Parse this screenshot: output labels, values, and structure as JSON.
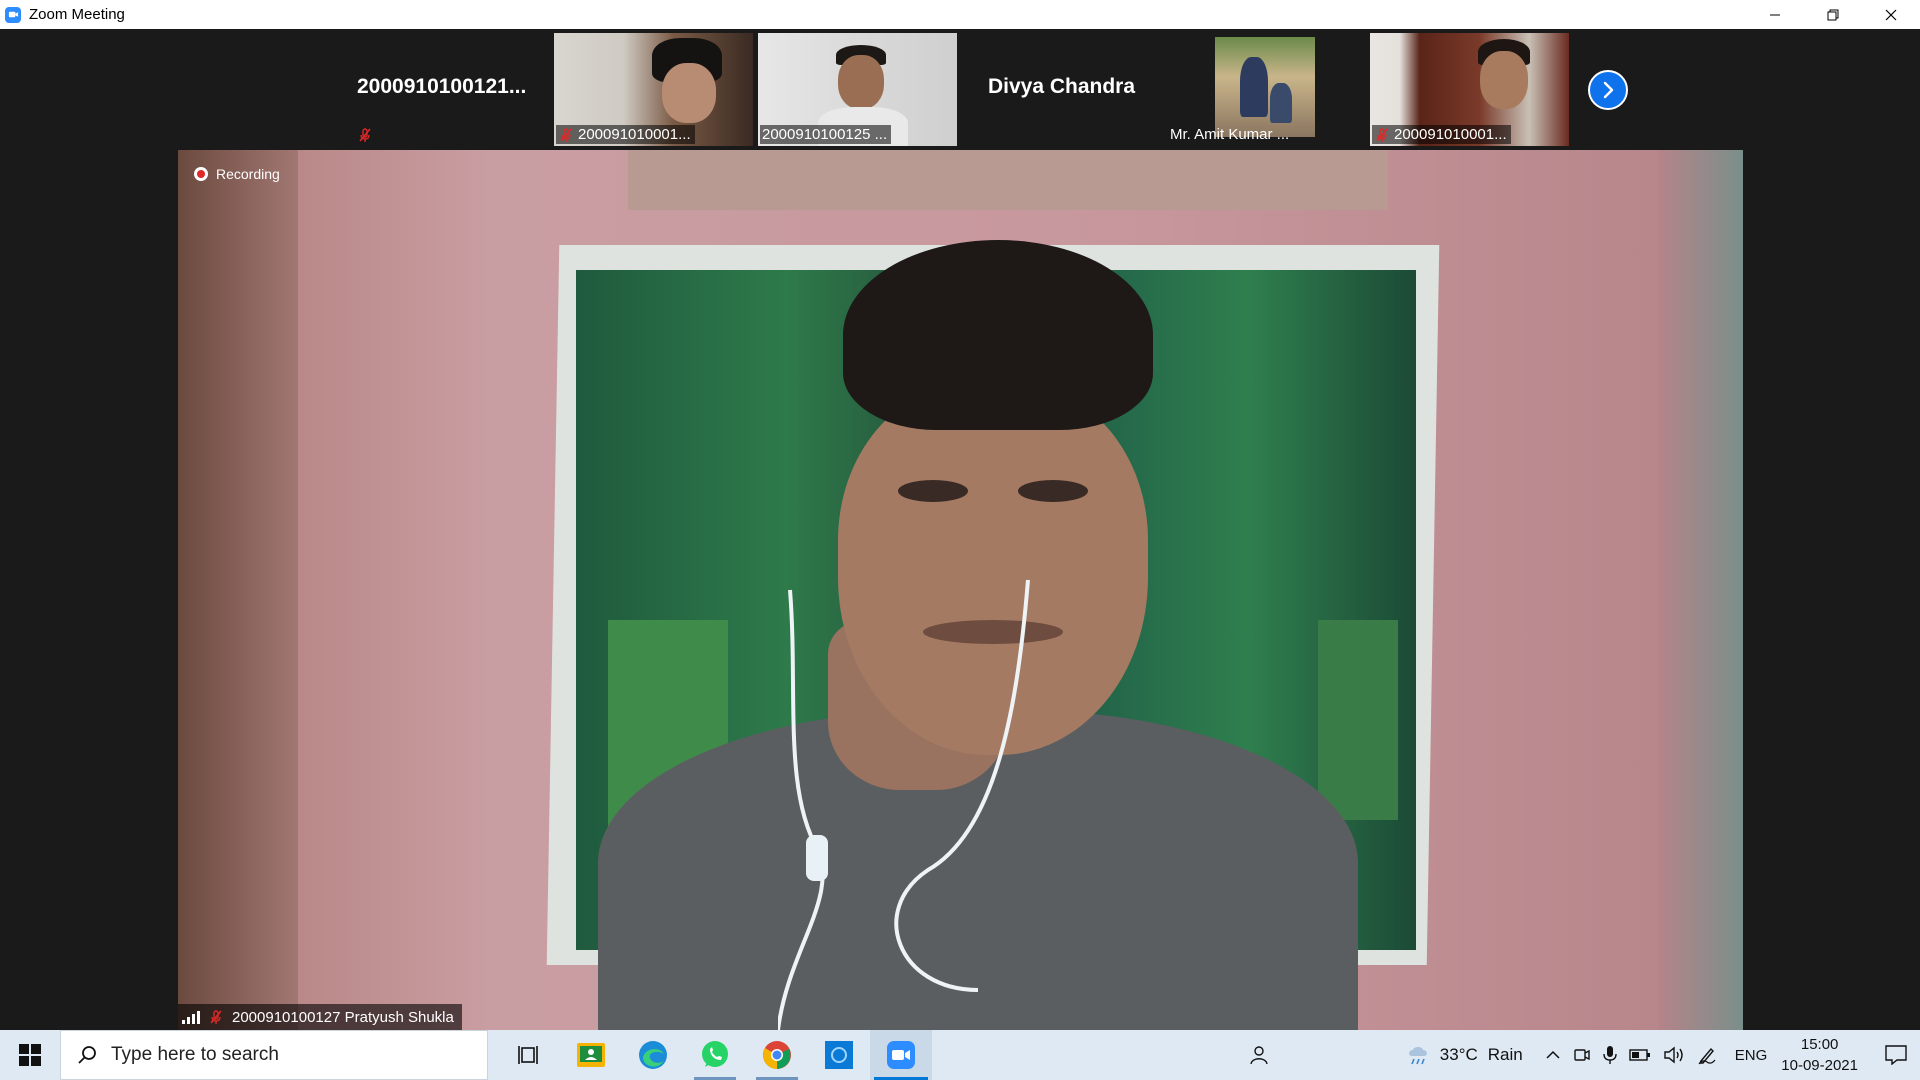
{
  "window": {
    "title": "Zoom Meeting"
  },
  "gallery": {
    "tiles": [
      {
        "name": "2000910100121...",
        "type": "name-only",
        "muted": true
      },
      {
        "name": "200091010001...",
        "type": "video",
        "muted": true
      },
      {
        "name": "2000910100125 ...",
        "type": "video",
        "muted": false
      },
      {
        "name": "Divya Chandra",
        "type": "name-only",
        "muted": false
      },
      {
        "name": "Mr. Amit Kumar ...",
        "type": "video",
        "muted": false
      },
      {
        "name": "200091010001...",
        "type": "video",
        "muted": true
      }
    ],
    "next_icon": "chevron-right-icon"
  },
  "speaker": {
    "recording_label": "Recording",
    "name": "2000910100127 Pratyush Shukla",
    "muted": true
  },
  "taskbar": {
    "search_placeholder": "Type here to search",
    "apps": [
      "task-view-icon",
      "google-classroom-icon",
      "edge-icon",
      "whatsapp-icon",
      "chrome-icon",
      "app-icon",
      "zoom-icon"
    ],
    "weather_temp": "33°C",
    "weather_desc": "Rain",
    "language": "ENG",
    "time": "15:00",
    "date": "10-09-2021"
  },
  "colors": {
    "zoom_blue": "#2d8cff",
    "next_button": "#0e72ed",
    "mute_red": "#e02828",
    "taskbar_bg": "#dfe9f3"
  }
}
